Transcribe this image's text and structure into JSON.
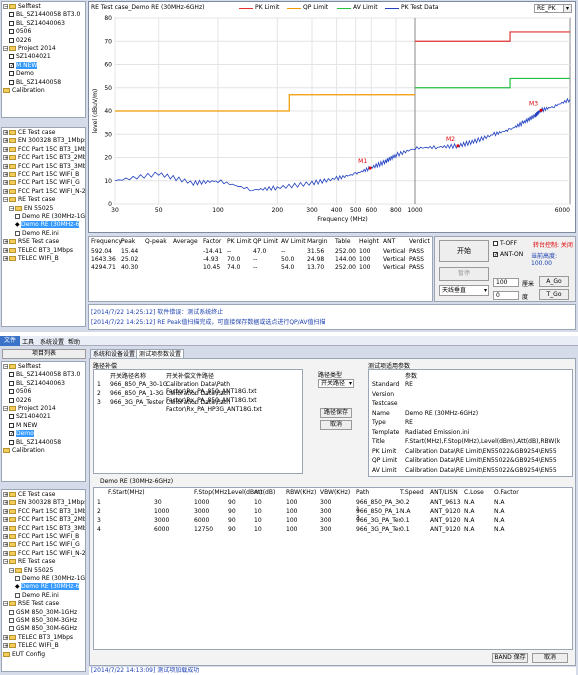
{
  "top": {
    "tree1": [
      "Selftest",
      "BL_SZ1440058 BT3.0",
      "BL_SZ14040063",
      "0506",
      "0226",
      "Project 2014",
      "SZ1404021",
      "M NEW",
      "Demo",
      "BL_SZ1440058",
      "Calibration"
    ],
    "tree2": [
      "CE Test case",
      "EN 300328 BT3_1Mbps",
      "FCC Part 15C BT3_1Mb",
      "FCC Part 15C BT3_2Mb",
      "FCC Part 15C BT3_3Mb",
      "FCC Part 15C WIFI_B",
      "FCC Part 15C WIFI_G",
      "FCC Part 15C WIFI_N-20",
      "RE Test case",
      "EN 55025",
      "Demo RE (30MHz-1G",
      "Demo RE (30MHz-6",
      "Demo RE.ini",
      "RSE Test case",
      "TELEC BT3_1Mbps",
      "TELEC WIFI_B"
    ],
    "chart_title": "RE Test case_Demo RE (30MHz-6GHz)",
    "legend": [
      "PK Limit",
      "QP Limit",
      "AV Limit",
      "PK Test Data"
    ],
    "mode": "RE_PK",
    "markers": [
      "M1",
      "M2",
      "M3"
    ],
    "table_headers": [
      "Frequency",
      "Peak",
      "Q-peak",
      "Average",
      "Factor",
      "PK Limit",
      "QP Limit",
      "AV Limit",
      "Margin",
      "Table",
      "Height",
      "ANT",
      "Verdict"
    ],
    "table_rows": [
      [
        "592.04",
        "15.44",
        "",
        "",
        "-14.41",
        "--",
        "47.0",
        "--",
        "31.56",
        "252.00",
        "100",
        "Vertical",
        "PASS"
      ],
      [
        "1643.36",
        "25.02",
        "",
        "",
        "-4.93",
        "70.0",
        "--",
        "50.0",
        "24.98",
        "144.00",
        "100",
        "Vertical",
        "PASS"
      ],
      [
        "4294.71",
        "40.30",
        "",
        "",
        "10.45",
        "74.0",
        "--",
        "54.0",
        "13.70",
        "252.00",
        "100",
        "Vertical",
        "PASS"
      ]
    ],
    "start_btn": "开始",
    "pause_btn": "暂停",
    "sky_label": "天线垂直",
    "toff": "T-OFF",
    "anton": "ANT-ON",
    "turn_label": "转台控制: 关闭",
    "height_label": "当前高度: 100.00",
    "h_value": "100",
    "h_unit": "厘米",
    "a_go": "A_Go",
    "deg_value": "0",
    "deg_unit": "度",
    "t_go": "T_Go",
    "log": [
      "[2014/7/22 14:25:12] 软件错误：测试系统终止",
      "[2014/7/22 14:25:12] RE Peak值扫描完成，可直接保存数据或选点进行QP/AV值扫描"
    ]
  },
  "bottom": {
    "menu": [
      "文件",
      "工具",
      "系统设置",
      "帮助"
    ],
    "item_list_btn": "项目列表",
    "tree1": [
      "Selftest",
      "BL_SZ1440058 BT3.0",
      "BL_SZ14040063",
      "0506",
      "0226",
      "Project 2014",
      "SZ1404021",
      "M NEW",
      "Demo",
      "BL_SZ1440058",
      "Calibration"
    ],
    "tree2": [
      "CE Test case",
      "EN 300328 BT3_1Mbps",
      "FCC Part 15C BT3_1Mb",
      "FCC Part 15C BT3_2Mb",
      "FCC Part 15C BT3_3Mb",
      "FCC Part 15C WIFI_B",
      "FCC Part 15C WIFI_G",
      "FCC Part 15C WIFI_N-20",
      "RE Test case",
      "EN 55025",
      "Demo RE (30MHz-1G",
      "Demo RE (30MHz-6",
      "Demo RE.ini",
      "RSE Test case",
      "GSM 850_30M-1GHz",
      "GSM 850_30M-3GHz",
      "GSM 850_30M-6GHz",
      "TELEC BT3_1Mbps",
      "TELEC WIFI_B",
      "EUT Config"
    ],
    "tabs": [
      "系统和设备设置",
      "测试项参数设置"
    ],
    "path_group": "路径补偿",
    "path_headers": [
      "开关路径名称",
      "开关补偿文件路径"
    ],
    "path_rows": [
      [
        "1",
        "966_850_PA_30-1G",
        "Calibration Data\\Path Factor\\Rx_PA_850_ANT18G.txt"
      ],
      [
        "2",
        "966_850_PA_1-3G",
        "Calibration Data\\Path Factor\\Rx_PA_850_ANT18G.txt"
      ],
      [
        "3",
        "966_3G_PA_Tester",
        "Calibration Data\\Path Factor\\Rx_PA_HP3G_ANT18G.txt"
      ]
    ],
    "path_type_label": "路径类型",
    "path_type_value": "开关路径",
    "path_save": "路径保存",
    "cancel": "取消",
    "params_group": "测试项适用参数",
    "param_header": "参数",
    "params": [
      [
        "Standard",
        "RE"
      ],
      [
        "Version",
        ""
      ],
      [
        "Testcase",
        ""
      ],
      [
        "Name",
        "Demo RE (30MHz-6GHz)"
      ],
      [
        "Type",
        "RE"
      ],
      [
        "Template",
        "Radiated Emission.ini"
      ],
      [
        "Title",
        "F.Start(MHz),F.Stop(MHz),Level(dBm),Att(dB),RBW(k"
      ],
      [
        "PK Limit",
        "Calibration Data\\RE Limit\\EN55022&GB9254\\EN55"
      ],
      [
        "QP Limit",
        "Calibration Data\\RE Limit\\EN55022&GB9254\\EN55"
      ],
      [
        "AV Limit",
        "Calibration Data\\RE Limit\\EN55022&GB9254\\EN55"
      ]
    ],
    "sweep_title": "Demo RE (30MHz-6GHz)",
    "sweep_headers": [
      "F.Start(MHz)",
      "F.Stop(MHz)",
      "Level(dBm)",
      "Att(dB)",
      "RBW(KHz)",
      "VBW(KHz)",
      "Path",
      "T.Speed",
      "ANT/LISN",
      "C.Lose",
      "O.Factor"
    ],
    "sweep_rows": [
      [
        "1",
        "30",
        "1000",
        "90",
        "10",
        "100",
        "300",
        "966_850_PA_30-1",
        "0.2",
        "ANT_9613",
        "N.A",
        "N.A"
      ],
      [
        "2",
        "1000",
        "3000",
        "90",
        "10",
        "100",
        "300",
        "966_850_PA_1-3",
        "N.A",
        "ANT_9120",
        "N.A",
        "N.A"
      ],
      [
        "3",
        "3000",
        "6000",
        "90",
        "10",
        "100",
        "300",
        "966_3G_PA_Teste",
        "0.1",
        "ANT_9120",
        "N.A",
        "N.A"
      ],
      [
        "4",
        "6000",
        "12750",
        "90",
        "10",
        "100",
        "300",
        "966_3G_PA_Teste",
        "0.1",
        "ANT_9120",
        "N.A",
        "N.A"
      ]
    ],
    "band_save": "BAND 保存",
    "cancel2": "取消",
    "status": "[2014/7/22 14:13:09] 测试项加载成功"
  },
  "chart_data": {
    "type": "line",
    "title": "RE Test case_Demo RE (30MHz-6GHz)",
    "xlabel": "Frequency (MHz)",
    "ylabel": "level (dBuV/m)",
    "ylim": [
      0,
      80
    ],
    "x_ticks_left": [
      "30",
      "50",
      "100",
      "200",
      "300",
      "400",
      "500",
      "600",
      "800",
      "1000"
    ],
    "x_ticks_right": [
      "1000",
      "6000"
    ],
    "y_ticks": [
      "0",
      "10",
      "20",
      "30",
      "40",
      "50",
      "60",
      "70",
      "80"
    ],
    "series": [
      {
        "name": "PK Limit",
        "color": "#e03030",
        "x": [
          1000,
          3000,
          3000,
          6000
        ],
        "y": [
          70,
          70,
          74,
          74
        ]
      },
      {
        "name": "QP Limit",
        "color": "#f09a00",
        "x": [
          30,
          230,
          230,
          1000
        ],
        "y": [
          40,
          40,
          47,
          47
        ]
      },
      {
        "name": "AV Limit",
        "color": "#20c040",
        "x": [
          1000,
          3000,
          3000,
          6000
        ],
        "y": [
          50,
          50,
          54,
          54
        ]
      },
      {
        "name": "PK Test Data",
        "color": "#2040c0",
        "x": [
          30,
          50,
          75,
          100,
          150,
          200,
          300,
          400,
          500,
          592,
          700,
          800,
          1000,
          1300,
          1643,
          2000,
          2500,
          3000,
          3500,
          4000,
          4294,
          5000,
          6000
        ],
        "y": [
          10,
          13,
          9,
          10,
          6,
          7,
          9,
          11,
          13,
          15.4,
          18,
          21,
          24,
          24.5,
          25,
          27,
          30,
          32,
          35,
          38,
          40.3,
          42,
          45
        ]
      }
    ],
    "markers": [
      {
        "name": "M1",
        "x": 592,
        "y": 15.44
      },
      {
        "name": "M2",
        "x": 1643,
        "y": 25.02
      },
      {
        "name": "M3",
        "x": 4294,
        "y": 40.3
      }
    ]
  }
}
